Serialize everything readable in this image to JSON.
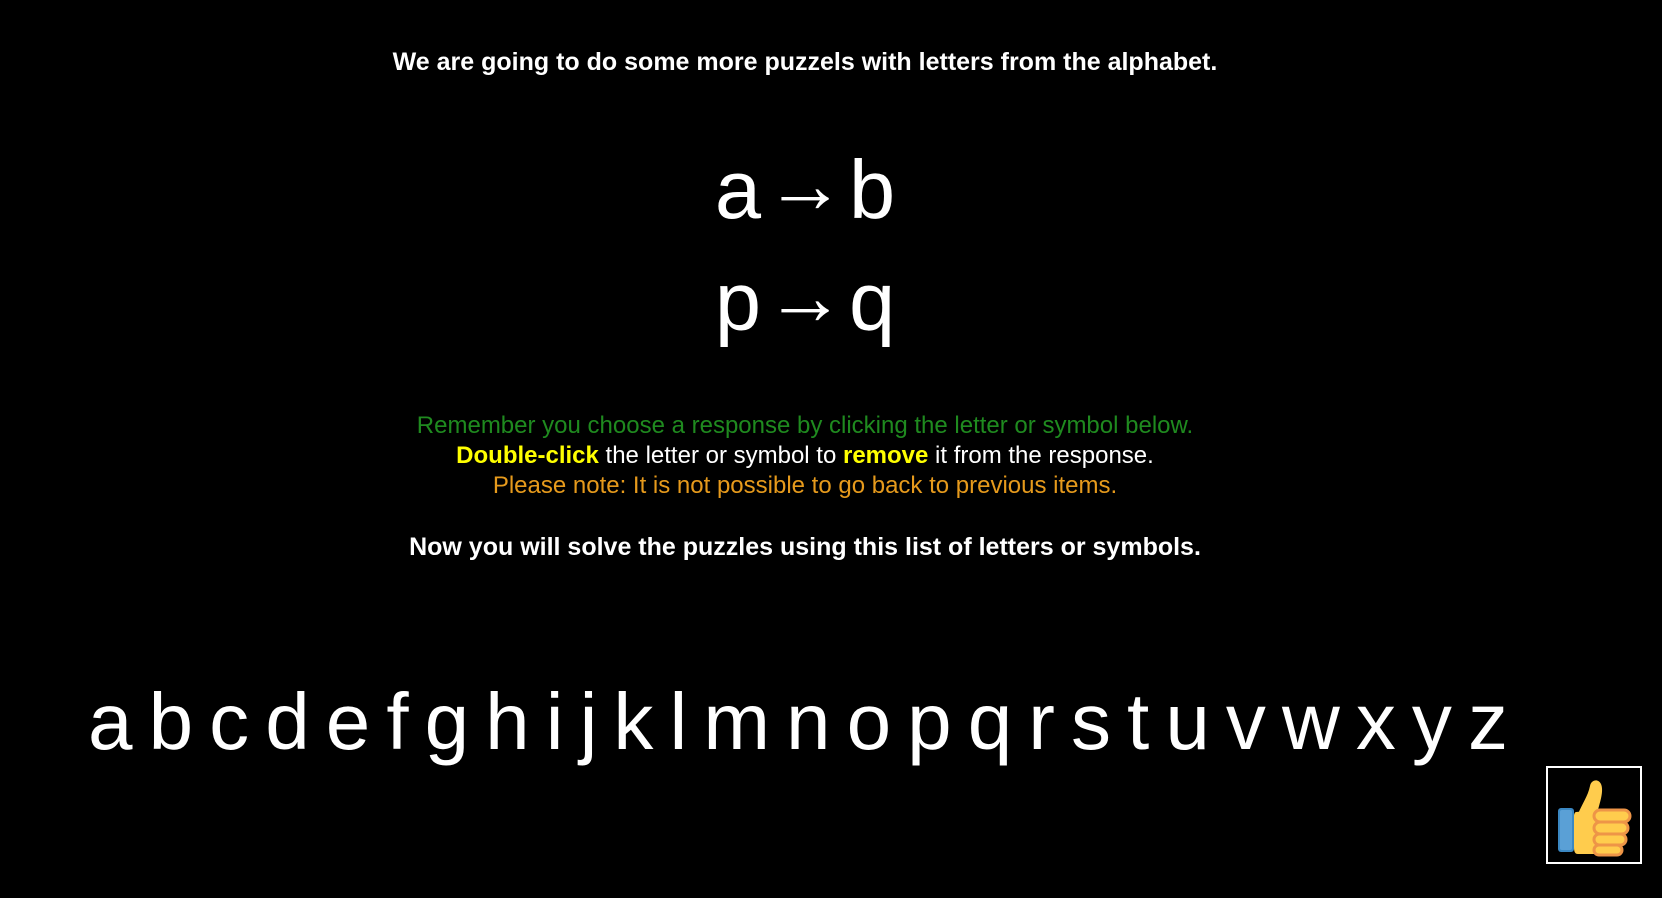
{
  "intro_text": "We are going to do some more puzzels with letters from the alphabet.",
  "examples": [
    {
      "from": "a",
      "arrow": "→",
      "to": "b"
    },
    {
      "from": "p",
      "arrow": "→",
      "to": "q"
    }
  ],
  "instructions": {
    "line1": "Remember you choose a response by clicking the letter or symbol below.",
    "line2": {
      "part1": "Double-click",
      "part2": " the letter or symbol to ",
      "part3": "remove",
      "part4": " it from the response."
    },
    "line3": "Please note: It is not possible to go back to previous items."
  },
  "solve_text": "Now you will solve the puzzles using this list of letters or symbols.",
  "alphabet": [
    "a",
    "b",
    "c",
    "d",
    "e",
    "f",
    "g",
    "h",
    "i",
    "j",
    "k",
    "l",
    "m",
    "n",
    "o",
    "p",
    "q",
    "r",
    "s",
    "t",
    "u",
    "v",
    "w",
    "x",
    "y",
    "z"
  ],
  "thumbs_button": {
    "icon": "thumbs-up-icon"
  },
  "colors": {
    "background": "#000000",
    "green": "#1f8a1f",
    "yellow": "#ffff00",
    "orange": "#e69a1c",
    "white": "#ffffff"
  }
}
